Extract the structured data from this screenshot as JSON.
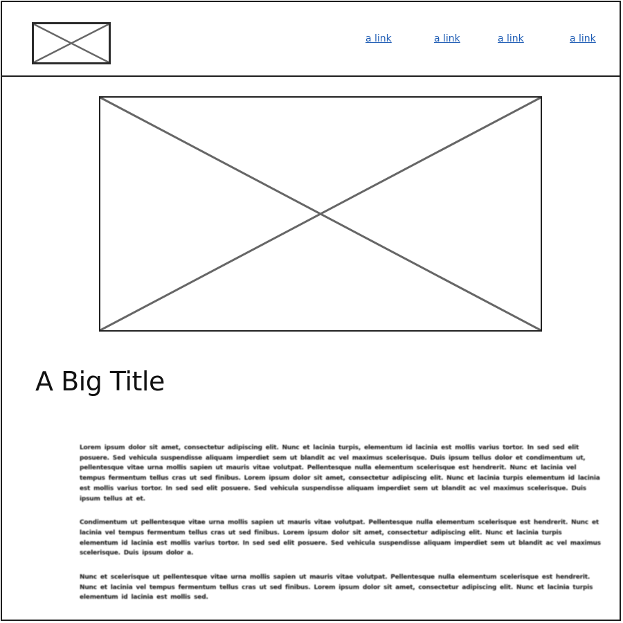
{
  "header": {
    "logo": {
      "icon": "image-placeholder-icon"
    },
    "nav": [
      {
        "label": "a link"
      },
      {
        "label": "a link"
      },
      {
        "label": "a link"
      },
      {
        "label": "a link"
      }
    ]
  },
  "hero": {
    "icon": "image-placeholder-icon"
  },
  "main": {
    "title": "A Big Title",
    "paragraphs": [
      "Lorem ipsum dolor sit amet, consectetur adipiscing elit. Nunc et lacinia turpis, elementum id lacinia est mollis varius tortor. In sed sed elit posuere. Sed vehicula suspendisse aliquam imperdiet sem ut blandit ac vel maximus scelerisque. Duis ipsum tellus dolor et condimentum ut, pellentesque vitae urna mollis sapien ut mauris vitae volutpat. Pellentesque nulla elementum scelerisque est hendrerit. Nunc et lacinia vel tempus fermentum tellus cras ut sed finibus. Lorem ipsum dolor sit amet, consectetur adipiscing elit. Nunc et lacinia turpis elementum id lacinia est mollis varius tortor. In sed sed elit posuere. Sed vehicula suspendisse aliquam imperdiet sem ut blandit ac vel maximus scelerisque. Duis ipsum tellus at et.",
      "Condimentum ut pellentesque vitae urna mollis sapien ut mauris vitae volutpat. Pellentesque nulla elementum scelerisque est hendrerit. Nunc et lacinia vel tempus fermentum tellus cras ut sed finibus. Lorem ipsum dolor sit amet, consectetur adipiscing elit. Nunc et lacinia turpis elementum id lacinia est mollis varius tortor. In sed sed elit posuere. Sed vehicula suspendisse aliquam imperdiet sem ut blandit ac vel maximus scelerisque. Duis ipsum dolor a.",
      "Nunc et scelerisque ut pellentesque vitae urna mollis sapien ut mauris vitae volutpat. Pellentesque nulla elementum scelerisque est hendrerit. Nunc et lacinia vel tempus fermentum tellus cras ut sed finibus. Lorem ipsum dolor sit amet, consectetur adipiscing elit. Nunc et lacinia turpis elementum id lacinia est mollis sed."
    ]
  },
  "colors": {
    "link": "#1f5db5",
    "border": "#1e1e1e",
    "placeholder_stroke": "#666666"
  }
}
